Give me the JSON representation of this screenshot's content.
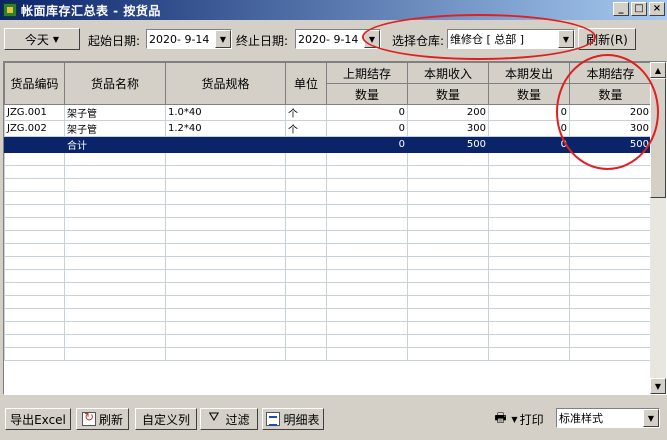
{
  "window": {
    "title": "帐面库存汇总表 - 按货品",
    "min": "_",
    "max": "□",
    "close": "×"
  },
  "toolbar": {
    "today_label": "今天",
    "start_label": "起始日期:",
    "start_value": "2020- 9-14",
    "end_label": "终止日期:",
    "end_value": "2020- 9-14",
    "warehouse_label": "选择仓库:",
    "warehouse_value": "维修仓 [ 总部 ]",
    "refresh_label": "刷新(R)"
  },
  "table": {
    "headers": {
      "code": "货品编码",
      "name": "货品名称",
      "spec": "货品规格",
      "unit": "单位",
      "prev_stock": "上期结存",
      "receipt": "本期收入",
      "issue": "本期发出",
      "closing": "本期结存",
      "qty": "数量"
    },
    "rows": [
      {
        "code": "JZG.001",
        "name": "架子管",
        "spec": "1.0*40",
        "unit": "个",
        "prev": "0",
        "in": "200",
        "out": "0",
        "closing": "200"
      },
      {
        "code": "JZG.002",
        "name": "架子管",
        "spec": "1.2*40",
        "unit": "个",
        "prev": "0",
        "in": "300",
        "out": "0",
        "closing": "300"
      }
    ],
    "total": {
      "label": "合计",
      "prev": "0",
      "in": "500",
      "out": "0",
      "closing": "500"
    }
  },
  "bottom": {
    "export_label": "导出Excel",
    "refresh_label": "刷新",
    "custom_columns_label": "自定义列",
    "filter_label": "过滤",
    "detail_label": "明细表",
    "print_label": "打印",
    "style_value": "标准样式"
  },
  "colors": {
    "selection": "#0a246a",
    "annotation": "#e02020",
    "titlebar": "#0a246a"
  }
}
